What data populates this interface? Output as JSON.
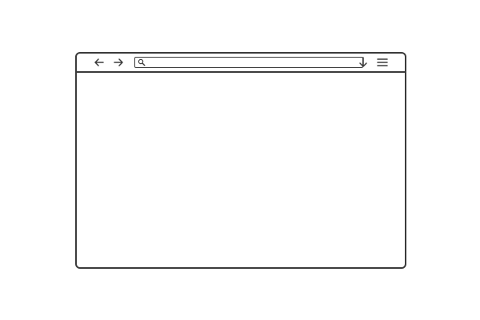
{
  "browser": {
    "toolbar": {
      "back_icon": "arrow-left-icon",
      "forward_icon": "arrow-right-icon",
      "search_icon": "search-icon",
      "download_icon": "arrow-down-icon",
      "menu_icon": "hamburger-menu-icon"
    },
    "address_bar": {
      "value": "",
      "placeholder": ""
    },
    "content": {
      "text": ""
    },
    "colors": {
      "stroke": "#3b3b3b",
      "background": "#ffffff"
    }
  }
}
